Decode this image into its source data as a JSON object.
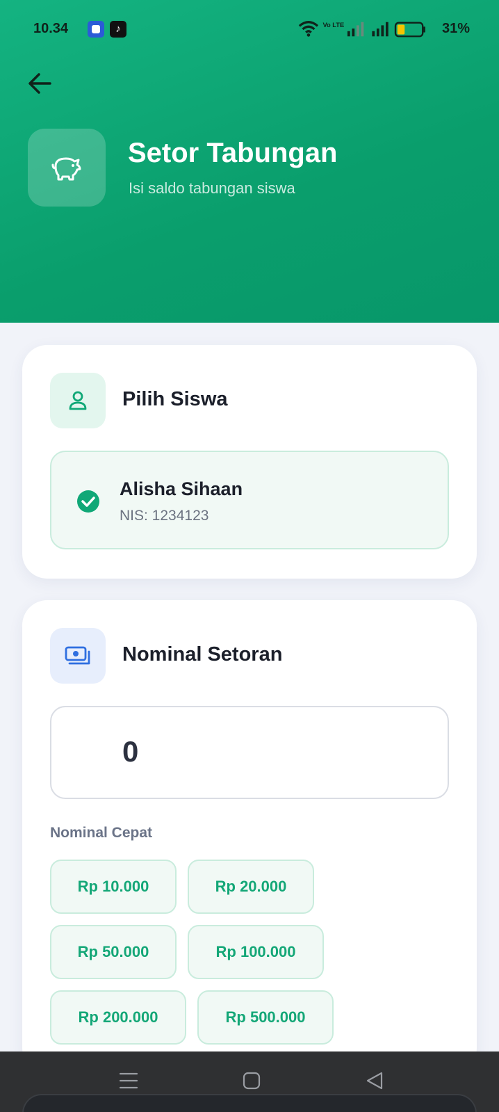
{
  "status_bar": {
    "time": "10.34",
    "battery_percent": "31%",
    "battery_level": 0.31,
    "network_label": "Vo LTE",
    "app_icons": [
      "edu-app-icon",
      "tiktok-icon"
    ]
  },
  "header": {
    "title": "Setor Tabungan",
    "subtitle": "Isi saldo tabungan siswa",
    "icon": "piggy-bank-icon"
  },
  "student_section": {
    "title": "Pilih Siswa",
    "icon": "user-icon",
    "selected": {
      "name": "Alisha Sihaan",
      "nis": "NIS: 1234123"
    }
  },
  "amount_section": {
    "title": "Nominal Setoran",
    "icon": "cash-icon",
    "amount_value": "0",
    "quick_label": "Nominal Cepat",
    "quick_amounts": [
      "Rp 10.000",
      "Rp 20.000",
      "Rp 50.000",
      "Rp 100.000",
      "Rp 200.000",
      "Rp 500.000"
    ]
  },
  "colors": {
    "primary": "#10a877",
    "header_gradient_start": "#14b381",
    "header_gradient_end": "#08976a",
    "chip_bg": "#f1f9f5",
    "chip_text": "#14a777"
  },
  "nav_bar": {
    "buttons": [
      "menu-icon",
      "home-icon",
      "back-triangle-icon"
    ]
  }
}
